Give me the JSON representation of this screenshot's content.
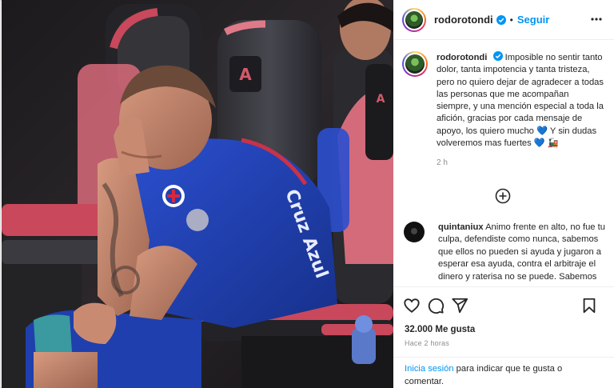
{
  "post": {
    "username": "rodorotondi",
    "follow_label": "Seguir",
    "separator": "•",
    "more_icon": "more-options-icon",
    "verified_color": "#0095f6"
  },
  "caption": {
    "username": "rodorotondi",
    "text": "Imposible no sentir tanto dolor, tanta impotencia y tanta tristeza, pero no quiero dejar de agradecer a todas las personas que me acompañan siempre, y una mención especial a toda la afición, gracias por cada mensaje de apoyo, los quiero mucho 💙 Y sin dudas volveremos mas fuertes 💙 🚂",
    "time": "2 h"
  },
  "comments": [
    {
      "username": "quintaniux",
      "text": "Animo frente en alto, no fue tu culpa, defendiste como nunca, sabemos que ellos no pueden si ayuda y jugaron a esperar esa ayuda, contra el arbitraje el dinero y raterisa no se puede. Sabemos que el fútbol mexicano es una"
    }
  ],
  "actions": {
    "likes": "32.000 Me gusta",
    "time_ago": "Hace 2 horas",
    "login_link": "Inicia sesión",
    "login_text": " para indicar que te gusta o comentar."
  },
  "photo": {
    "jersey_text": "Cruz Azul",
    "seat_brand": "Estadio Azteca"
  },
  "colors": {
    "accent": "#0095f6",
    "text": "#262626",
    "muted": "#8e8e8e",
    "jersey": "#1f3fae",
    "seat_red": "#c9485b"
  }
}
